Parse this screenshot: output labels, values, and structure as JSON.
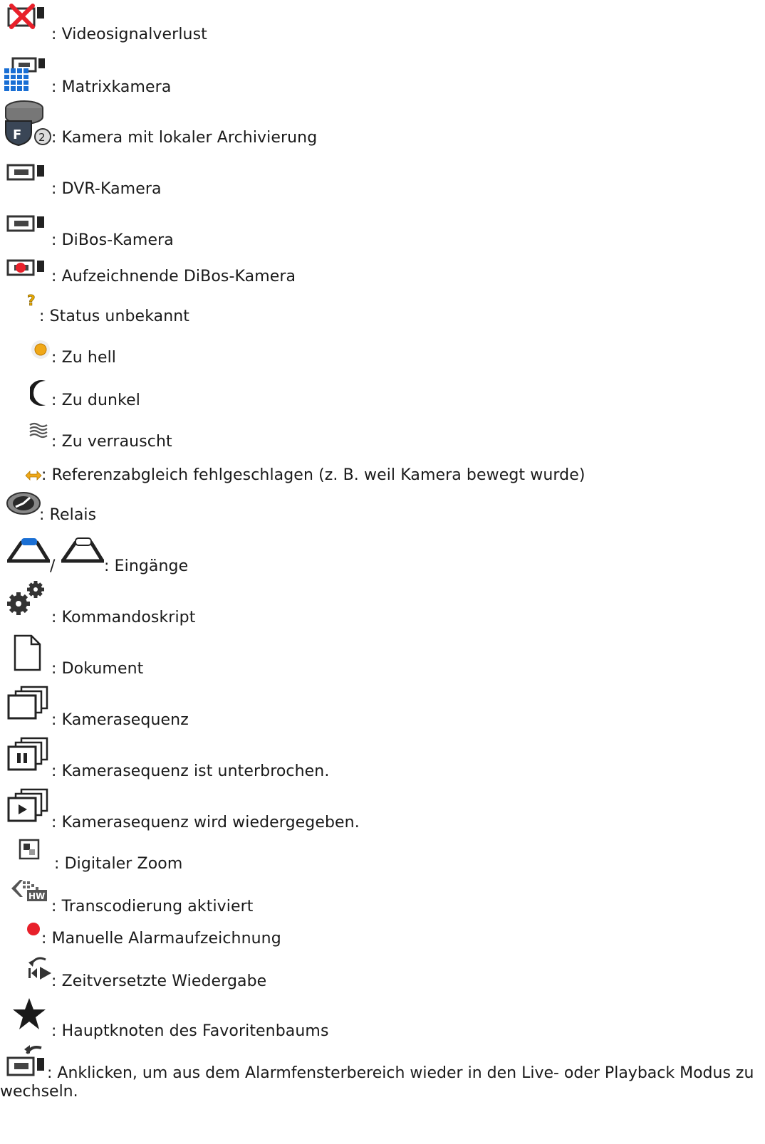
{
  "items": [
    {
      "icon": "camera-signal-loss-icon",
      "label": ": Videosignalverlust"
    },
    {
      "icon": "matrix-camera-icon",
      "label": ": Matrixkamera"
    },
    {
      "icon": "local-archive-camera-icon",
      "label": ": Kamera mit lokaler Archivierung"
    },
    {
      "icon": "dvr-camera-icon",
      "label": ": DVR-Kamera"
    },
    {
      "icon": "dibos-camera-icon",
      "label": ": DiBos-Kamera"
    },
    {
      "icon": "recording-dibos-camera-icon",
      "label": ": Aufzeichnende DiBos-Kamera"
    },
    {
      "icon": "question-mark-icon",
      "label": ": Status unbekannt"
    },
    {
      "icon": "sun-icon",
      "label": ": Zu hell"
    },
    {
      "icon": "moon-icon",
      "label": ": Zu dunkel"
    },
    {
      "icon": "noise-icon",
      "label": ": Zu verrauscht"
    },
    {
      "icon": "double-arrow-icon",
      "label": ": Referenzabgleich fehlgeschlagen (z. B. weil Kamera bewegt wurde)"
    },
    {
      "icon": "relay-icon",
      "label": ": Relais"
    },
    {
      "icon": "input-icon",
      "label": ": Eingänge",
      "separator": "/"
    },
    {
      "icon": "gears-icon",
      "label": ": Kommandoskript"
    },
    {
      "icon": "document-icon",
      "label": ": Dokument"
    },
    {
      "icon": "camera-sequence-icon",
      "label": ": Kamerasequenz"
    },
    {
      "icon": "sequence-paused-icon",
      "label": ": Kamerasequenz ist unterbrochen."
    },
    {
      "icon": "sequence-playing-icon",
      "label": ": Kamerasequenz wird wiedergegeben."
    },
    {
      "icon": "digital-zoom-icon",
      "label": ": Digitaler Zoom"
    },
    {
      "icon": "transcoding-icon",
      "label": ": Transcodierung aktiviert"
    },
    {
      "icon": "red-dot-icon",
      "label": ": Manuelle Alarmaufzeichnung"
    },
    {
      "icon": "instant-playback-icon",
      "label": ": Zeitversetzte Wiedergabe"
    },
    {
      "icon": "star-icon",
      "label": ": Hauptknoten des Favoritenbaums"
    },
    {
      "icon": "return-camera-icon",
      "label": ": Anklicken, um aus dem Alarmfensterbereich wieder in den Live- oder Playback Modus zu wechseln."
    }
  ],
  "hw_badge": "HW",
  "colors": {
    "red": "#e8202a",
    "blue": "#1a6fd4",
    "orange": "#f0a818",
    "gray": "#8a8a8a",
    "dark": "#222222"
  }
}
